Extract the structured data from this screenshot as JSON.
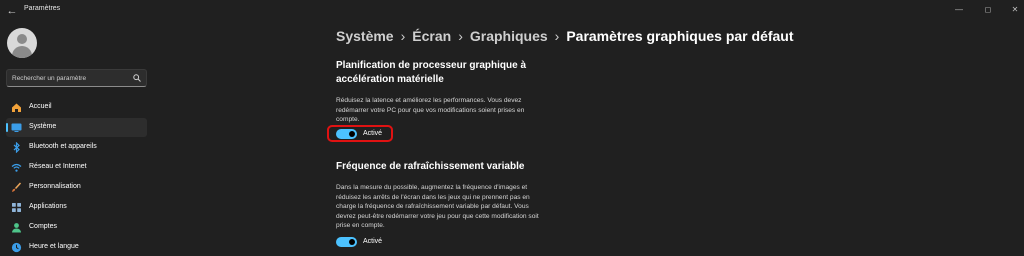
{
  "window": {
    "title": "Paramètres",
    "back_icon": "back-arrow-icon",
    "controls": [
      "minimize-icon",
      "maximize-icon",
      "close-icon"
    ]
  },
  "search": {
    "placeholder": "Rechercher un paramètre",
    "icon": "search-icon"
  },
  "sidebar": {
    "items": [
      {
        "label": "Accueil",
        "icon": "home-icon",
        "active": false
      },
      {
        "label": "Système",
        "icon": "monitor-icon",
        "active": true
      },
      {
        "label": "Bluetooth et appareils",
        "icon": "bluetooth-icon",
        "active": false
      },
      {
        "label": "Réseau et Internet",
        "icon": "wifi-icon",
        "active": false
      },
      {
        "label": "Personnalisation",
        "icon": "brush-icon",
        "active": false
      },
      {
        "label": "Applications",
        "icon": "apps-icon",
        "active": false
      },
      {
        "label": "Comptes",
        "icon": "account-icon",
        "active": false
      },
      {
        "label": "Heure et langue",
        "icon": "globe-clock-icon",
        "active": false
      }
    ]
  },
  "breadcrumb": {
    "items": [
      "Système",
      "Écran",
      "Graphiques"
    ],
    "separator": "›",
    "current": "Paramètres graphiques par défaut"
  },
  "sections": [
    {
      "title": "Planification de processeur graphique à accélération matérielle",
      "description": "Réduisez la latence et améliorez les performances. Vous devez redémarrer votre PC pour que vos modifications soient prises en compte.",
      "toggle_label": "Activé",
      "toggle_on": true
    },
    {
      "title": "Fréquence de rafraîchissement variable",
      "description": "Dans la mesure du possible, augmentez la fréquence d'images et réduisez les arrêts de l'écran dans les jeux qui ne prennent pas en charge la fréquence de rafraîchissement variable par défaut. Vous devrez peut-être redémarrer votre jeu pour que cette modification soit prise en compte.",
      "toggle_label": "Activé",
      "toggle_on": true
    }
  ],
  "colors": {
    "background": "#202020",
    "accent": "#4cc2ff",
    "highlight": "#e01212"
  }
}
